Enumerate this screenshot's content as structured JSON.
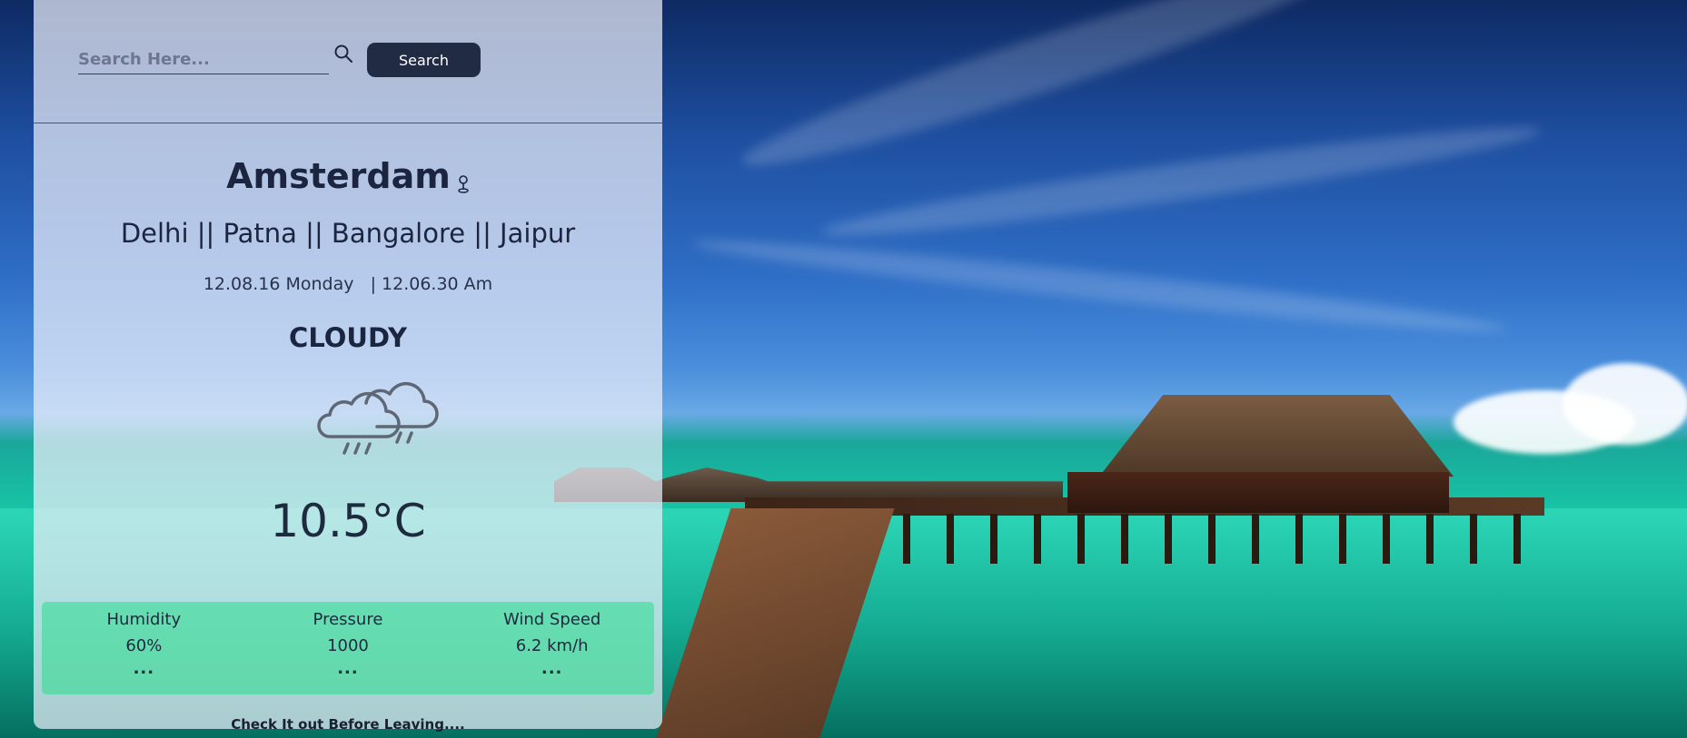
{
  "search": {
    "placeholder": "Search Here...",
    "button_label": "Search"
  },
  "location": {
    "city": "Amsterdam",
    "other_cities": "Delhi || Patna || Bangalore || Jaipur"
  },
  "datetime": "12.08.16 Monday   | 12.06.30 Am",
  "weather": {
    "condition": "CLOUDY",
    "icon": "rain-cloud-icon",
    "temperature": "10.5°C"
  },
  "stats": [
    {
      "label": "Humidity",
      "value": "60%",
      "more": "..."
    },
    {
      "label": "Pressure",
      "value": "1000",
      "more": "..."
    },
    {
      "label": "Wind Speed",
      "value": "6.2 km/h",
      "more": "..."
    }
  ],
  "footer_note": "Check It out Before Leaving....",
  "colors": {
    "button_bg": "#212c44",
    "stats_bg": "#28dc8c",
    "text_dark": "#1c2540"
  }
}
